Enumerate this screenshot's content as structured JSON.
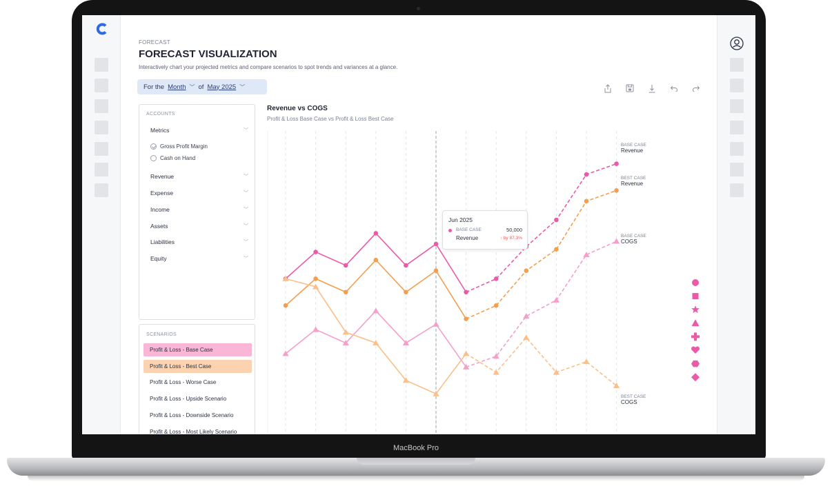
{
  "device": {
    "brand_label": "MacBook Pro"
  },
  "header": {
    "breadcrumb": "FORECAST",
    "title": "FORECAST VISUALIZATION",
    "subtitle": "Interactively chart your projected metrics and compare scenarios to spot trends and variances at a glance."
  },
  "period": {
    "prefix": "For the",
    "unit": "Month",
    "of": "of",
    "value": "May 2025"
  },
  "toolbar": {
    "icons": [
      "share-icon",
      "save-icon",
      "download-icon",
      "undo-icon",
      "redo-icon"
    ]
  },
  "accounts": {
    "label": "ACCOUNTS",
    "metrics_label": "Metrics",
    "metric_options": [
      {
        "label": "Gross Profit Margin",
        "checked": true
      },
      {
        "label": "Cash on Hand",
        "checked": false
      }
    ],
    "groups": [
      "Revenue",
      "Expense",
      "Income",
      "Assets",
      "Liabilities",
      "Equity"
    ]
  },
  "scenarios": {
    "label": "SCENARIOS",
    "items": [
      {
        "label": "Profit & Loss - Base Case",
        "highlight": "#f9b6d6"
      },
      {
        "label": "Profit & Loss - Best Case",
        "highlight": "#fbd3b0"
      },
      {
        "label": "Profit & Loss - Worse Case",
        "highlight": ""
      },
      {
        "label": "Profit & Loss - Upside Scenario",
        "highlight": ""
      },
      {
        "label": "Profit & Loss - Downside Scenario",
        "highlight": ""
      },
      {
        "label": "Profit & Loss - Most Likely Scenario",
        "highlight": ""
      }
    ]
  },
  "chart": {
    "title": "Revenue vs COGS",
    "subtitle": "Profit & Loss Base Case vs Profit & Loss Best Case",
    "tooltip": {
      "title": "Jun 2025",
      "case": "BASE CASE",
      "metric": "Revenue",
      "value": "50,000",
      "delta": "by 87.3%"
    },
    "end_labels": [
      {
        "case": "BASE CASE",
        "metric": "Revenue"
      },
      {
        "case": "BEST CASE",
        "metric": "Revenue"
      },
      {
        "case": "BASE CASE",
        "metric": "COGS"
      },
      {
        "case": "BEST CASE",
        "metric": "COGS"
      }
    ],
    "legend_shapes": [
      "circle-icon",
      "square-icon",
      "star-icon",
      "triangle-icon",
      "plus-icon",
      "heart-icon",
      "hexagon-icon",
      "diamond-icon"
    ]
  },
  "chart_data": {
    "type": "line",
    "title": "Revenue vs COGS",
    "subtitle": "Profit & Loss Base Case vs Profit & Loss Best Case",
    "x_count": 12,
    "actual_until_index": 6,
    "ylim": [
      0,
      100
    ],
    "grid": "vertical dashed",
    "colors": {
      "base_revenue": "#ea5aa8",
      "best_revenue": "#f2a04f",
      "base_cogs": "#f59fca",
      "best_cogs": "#fac08a"
    },
    "series": [
      {
        "name": "BASE CASE Revenue",
        "marker": "circle",
        "values": [
          53,
          63,
          58,
          70,
          58,
          66,
          48,
          53,
          65,
          75,
          92,
          96
        ]
      },
      {
        "name": "BEST CASE Revenue",
        "marker": "circle",
        "values": [
          43,
          53,
          48,
          60,
          48,
          56,
          38,
          43,
          56,
          64,
          82,
          86
        ]
      },
      {
        "name": "BASE CASE COGS",
        "marker": "triangle",
        "values": [
          25,
          34,
          29,
          41,
          29,
          36,
          20,
          24,
          39,
          45,
          62,
          67
        ]
      },
      {
        "name": "BEST CASE COGS",
        "marker": "triangle",
        "values": [
          53,
          50,
          33,
          29,
          15,
          10,
          25,
          18,
          31,
          18,
          22,
          13
        ]
      }
    ]
  }
}
